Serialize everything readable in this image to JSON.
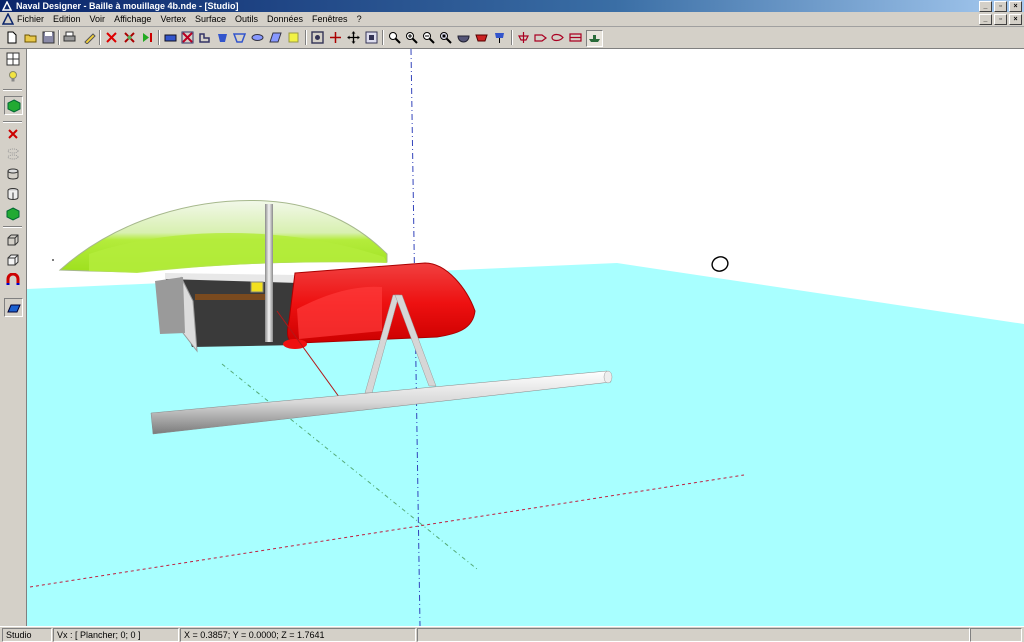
{
  "window": {
    "title": "Naval Designer - Baille à mouillage 4b.nde - [Studio]",
    "controls": [
      "_",
      "▫",
      "×"
    ]
  },
  "menu": {
    "items": [
      "Fichier",
      "Edition",
      "Voir",
      "Affichage",
      "Vertex",
      "Surface",
      "Outils",
      "Données",
      "Fenêtres",
      "?"
    ]
  },
  "toolbar": {
    "buttons": [
      {
        "name": "new-file-icon"
      },
      {
        "name": "open-file-icon"
      },
      {
        "name": "save-icon"
      },
      {
        "name": "print-icon"
      },
      {
        "name": "pencil-icon"
      },
      {
        "name": "vertex-cross-icon"
      },
      {
        "name": "vertex-cross-alt-icon"
      },
      {
        "name": "play-icon"
      },
      {
        "name": "shape-1-icon"
      },
      {
        "name": "shape-2-icon"
      },
      {
        "name": "shape-3-icon"
      },
      {
        "name": "shape-4-icon"
      },
      {
        "name": "shape-5-icon"
      },
      {
        "name": "shape-6-icon"
      },
      {
        "name": "shape-7-icon"
      },
      {
        "name": "light-icon"
      },
      {
        "name": "view-frame-icon"
      },
      {
        "name": "move-icon"
      },
      {
        "name": "pan-icon"
      },
      {
        "name": "fit-icon"
      },
      {
        "name": "zoom-window-icon"
      },
      {
        "name": "zoom-in-icon"
      },
      {
        "name": "zoom-out-icon"
      },
      {
        "name": "zoom-all-icon"
      },
      {
        "name": "bowl-icon"
      },
      {
        "name": "section-icon"
      },
      {
        "name": "view-front-icon"
      },
      {
        "name": "view-side-icon"
      },
      {
        "name": "view-top-icon"
      },
      {
        "name": "view-back-icon"
      },
      {
        "name": "view-3d-icon"
      }
    ]
  },
  "left_toolbar": {
    "buttons": [
      {
        "name": "layout-split-icon"
      },
      {
        "name": "light-bulb-icon"
      },
      {
        "name": "green-cube-icon"
      },
      {
        "name": "delete-icon"
      },
      {
        "name": "ghost-cylinder-icon"
      },
      {
        "name": "cylinder-icon"
      },
      {
        "name": "cylinder-alt-icon"
      },
      {
        "name": "solid-cube-icon"
      },
      {
        "name": "wire-cube-icon"
      },
      {
        "name": "box-icon"
      },
      {
        "name": "magnet-icon"
      },
      {
        "name": "plane-icon"
      }
    ]
  },
  "status": {
    "mode": "Studio",
    "vertex": "Vx : [ Plancher; 0; 0 ]",
    "coords": "X = 0.3857; Y = 0.0000; Z = 1.7641",
    "empty1": "",
    "empty2": ""
  },
  "colors": {
    "water": "#a8ffff",
    "hull_red": "#ee1111",
    "canopy_green": "#b4ec3c",
    "title_bar": "#0a246a"
  }
}
